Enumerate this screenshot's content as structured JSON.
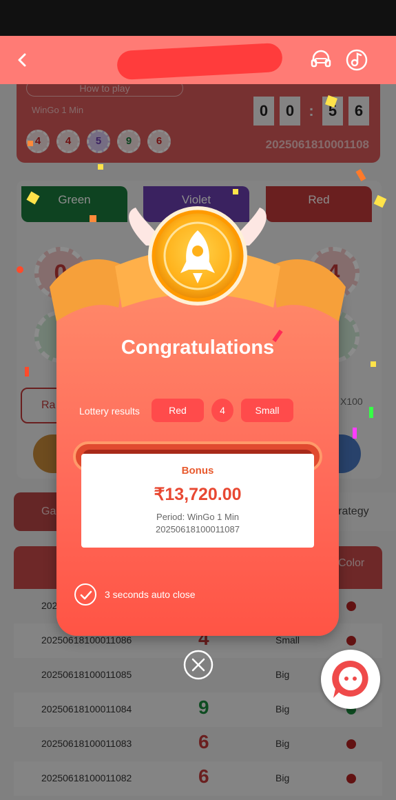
{
  "header": {
    "back_icon": "chevron-left-icon",
    "support_icon": "headset-icon",
    "music_icon": "music-note-icon"
  },
  "game": {
    "how_to_play": "How to play",
    "mode": "WinGo 1 Min",
    "recent_balls": [
      "4",
      "4",
      "5",
      "9",
      "6"
    ],
    "timer": [
      "0",
      "0",
      ":",
      "5",
      "6"
    ],
    "period": "2025061810001108"
  },
  "bets": {
    "green": "Green",
    "violet": "Violet",
    "red": "Red",
    "big_balls": [
      "0",
      "4"
    ],
    "random": "Ra",
    "multiplier": "X100"
  },
  "tabs": {
    "game": "Ga",
    "strategy": "w Strategy"
  },
  "history": {
    "color_header": "Color",
    "rows": [
      {
        "period": "202",
        "number": "",
        "size": "",
        "color": "red"
      },
      {
        "period": "20250618100011086",
        "number": "4",
        "size": "Small",
        "color": "red"
      },
      {
        "period": "20250618100011085",
        "number": "",
        "size": "Big",
        "color": "green"
      },
      {
        "period": "20250618100011084",
        "number": "9",
        "size": "Big",
        "color": "green"
      },
      {
        "period": "20250618100011083",
        "number": "6",
        "size": "Big",
        "color": "red"
      },
      {
        "period": "20250618100011082",
        "number": "6",
        "size": "Big",
        "color": "red"
      }
    ]
  },
  "modal": {
    "title": "Congratulations",
    "lottery_label": "Lottery results",
    "result_color": "Red",
    "result_number": "4",
    "result_size": "Small",
    "bonus_label": "Bonus",
    "bonus_amount": "₹13,720.00",
    "bonus_period": "Period: WinGo 1 Min",
    "bonus_id": "20250618100011087",
    "auto_close": "3 seconds auto close"
  },
  "colors": {
    "accent": "#ff6b5a",
    "red": "#c23a3a",
    "green": "#1a7a3c",
    "violet": "#6a3fb0"
  }
}
